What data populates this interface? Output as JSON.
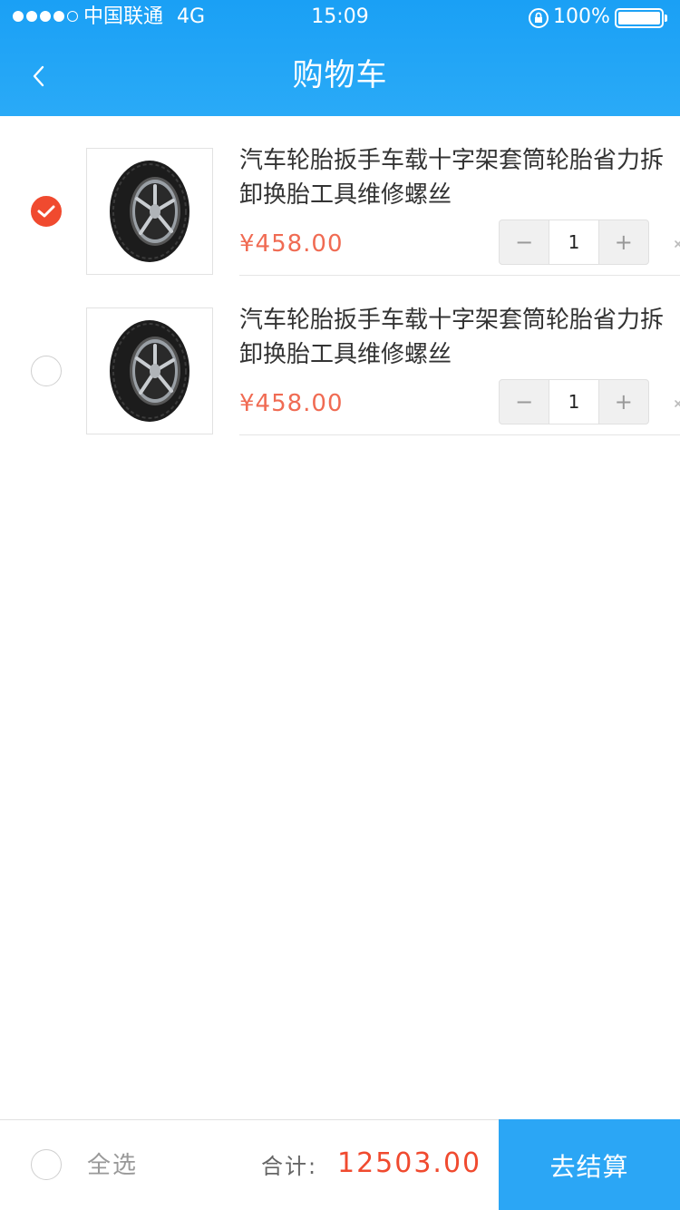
{
  "status_bar": {
    "carrier": "中国联通",
    "network": "4G",
    "time": "15:09",
    "battery": "100%",
    "signal_bars_filled": 4,
    "signal_bars_total": 5
  },
  "nav": {
    "title": "购物车",
    "back_icon": "chevron-left-icon"
  },
  "colors": {
    "header_blue": "#1aa0f5",
    "accent_red": "#f04a2f",
    "price_red": "#f06b53",
    "checkout_blue": "#2ba6f5"
  },
  "cart": {
    "items": [
      {
        "title": "汽车轮胎扳手车载十字架套筒轮胎省力拆卸换胎工具维修螺丝",
        "price": "¥458.00",
        "quantity": "1",
        "checked": true,
        "image_icon": "tire-image"
      },
      {
        "title": "汽车轮胎扳手车载十字架套筒轮胎省力拆卸换胎工具维修螺丝",
        "price": "¥458.00",
        "quantity": "1",
        "checked": false,
        "image_icon": "tire-image"
      }
    ],
    "stepper": {
      "minus_label": "−",
      "plus_label": "+"
    }
  },
  "footer": {
    "select_all_label": "全选",
    "total_label": "合计:",
    "total_amount": "12503.00",
    "checkout_label": "去结算"
  }
}
